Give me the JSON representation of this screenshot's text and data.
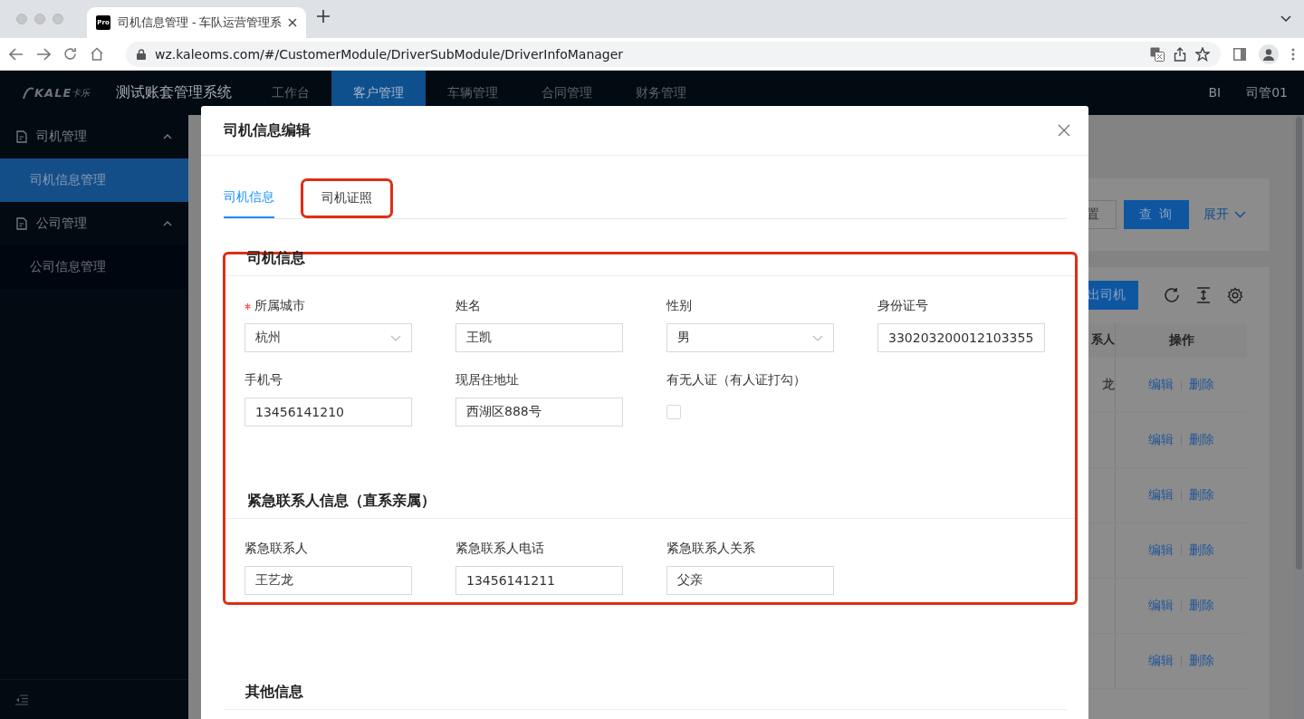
{
  "browser": {
    "favicon": "Pro",
    "tab_title": "司机信息管理 - 车队运营管理系",
    "url": "wz.kaleoms.com/#/CustomerModule/DriverSubModule/DriverInfoManager"
  },
  "header": {
    "logo_text": "KALE",
    "logo_subtext": "卡乐",
    "title": "测试账套管理系统",
    "nav": [
      {
        "label": "工作台",
        "selected": false
      },
      {
        "label": "客户管理",
        "selected": true
      },
      {
        "label": "车辆管理",
        "selected": false
      },
      {
        "label": "合同管理",
        "selected": false
      },
      {
        "label": "财务管理",
        "selected": false
      }
    ],
    "right": [
      "BI",
      "司管01"
    ]
  },
  "sidebar": {
    "groups": [
      {
        "label": "司机管理",
        "expanded": true,
        "items": [
          {
            "label": "司机信息管理",
            "selected": true
          }
        ]
      },
      {
        "label": "公司管理",
        "expanded": true,
        "items": [
          {
            "label": "公司信息管理",
            "selected": false
          }
        ]
      }
    ]
  },
  "background": {
    "search_buttons": [
      {
        "label": "置",
        "kind": "default"
      },
      {
        "label": "查 询",
        "kind": "primary"
      },
      {
        "label": "展开",
        "kind": "link"
      }
    ],
    "export_button": "出司机",
    "table": {
      "columns": [
        "系人",
        "操作"
      ],
      "rows": [
        {
          "column_1": "龙",
          "actions": [
            "编辑",
            "删除"
          ]
        },
        {
          "actions": [
            "编辑",
            "删除"
          ]
        },
        {
          "actions": [
            "编辑",
            "删除"
          ]
        },
        {
          "actions": [
            "编辑",
            "删除"
          ]
        },
        {
          "actions": [
            "编辑",
            "删除"
          ]
        },
        {
          "actions": [
            "编辑",
            "删除"
          ]
        }
      ]
    }
  },
  "modal": {
    "title": "司机信息编辑",
    "tabs": [
      {
        "label": "司机信息",
        "selected": true,
        "highlighted": false
      },
      {
        "label": "司机证照",
        "selected": false,
        "highlighted": true
      }
    ],
    "sections": [
      {
        "title": "司机信息",
        "highlighted": true,
        "fields": [
          {
            "label": "所属城市",
            "required": true,
            "kind": "select",
            "value": "杭州"
          },
          {
            "label": "姓名",
            "required": false,
            "kind": "text",
            "value": "王凯"
          },
          {
            "label": "性别",
            "required": false,
            "kind": "select",
            "value": "男"
          },
          {
            "label": "身份证号",
            "required": false,
            "kind": "text",
            "value": "330203200012103355"
          },
          {
            "label": "手机号",
            "required": false,
            "kind": "text",
            "value": "13456141210"
          },
          {
            "label": "现居住地址",
            "required": false,
            "kind": "text",
            "value": "西湖区888号"
          },
          {
            "label": "有无人证（有人证打勾）",
            "required": false,
            "kind": "checkbox",
            "checked": false
          }
        ]
      },
      {
        "title": "紧急联系人信息（直系亲属）",
        "highlighted": true,
        "fields": [
          {
            "label": "紧急联系人",
            "required": false,
            "kind": "text",
            "value": "王艺龙"
          },
          {
            "label": "紧急联系人电话",
            "required": false,
            "kind": "text",
            "value": "13456141211"
          },
          {
            "label": "紧急联系人关系",
            "required": false,
            "kind": "text",
            "value": "父亲"
          }
        ]
      },
      {
        "title": "其他信息",
        "highlighted": false
      }
    ]
  }
}
